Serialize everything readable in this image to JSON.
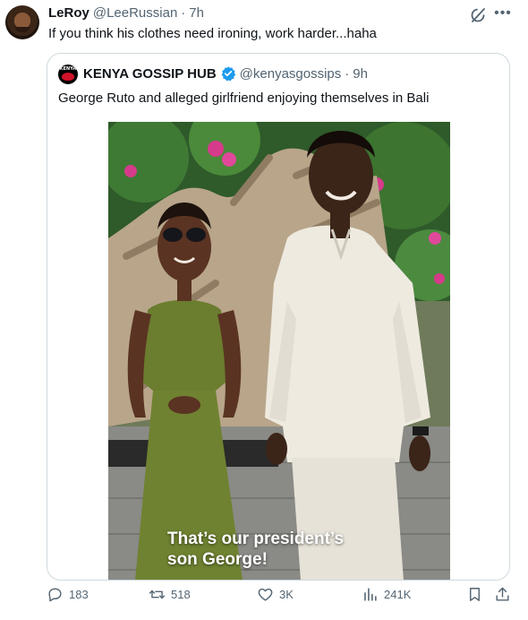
{
  "post": {
    "author_name": "LeRoy",
    "author_handle": "@LeeRussian",
    "separator": "·",
    "time": "7h",
    "text": "If you think his clothes need ironing, work harder...haha"
  },
  "quoted": {
    "author_name": "KENYA GOSSIP HUB",
    "author_handle": "@kenyasgossips",
    "separator": "·",
    "time": "9h",
    "text": "George Ruto and alleged girlfriend enjoying themselves in Bali",
    "avatar_text": "KENYA",
    "image_caption_line1": "That’s our president’s",
    "image_caption_line2": "son George!"
  },
  "actions": {
    "replies": "183",
    "reposts": "518",
    "likes": "3K",
    "views": "241K"
  },
  "icons": [
    "grok-icon",
    "more-icon",
    "verified-badge-icon",
    "reply-icon",
    "repost-icon",
    "like-icon",
    "views-icon",
    "bookmark-icon",
    "share-icon"
  ],
  "colors": {
    "text": "#0f1419",
    "muted": "#536471",
    "verified": "#1d9bf0",
    "border": "#cfd9de"
  }
}
